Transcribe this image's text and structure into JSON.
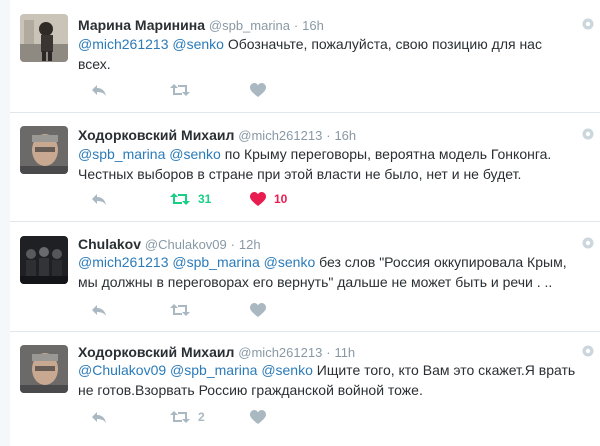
{
  "tweets": [
    {
      "name": "Марина Маринина",
      "handle": "@spb_marina",
      "time": "16h",
      "mentions": [
        "@mich261213",
        "@senko"
      ],
      "body": "Обозначьте, пожалуйста, свою позицию для нас всех.",
      "retweets": "",
      "likes": "",
      "retweeted": false,
      "liked": false
    },
    {
      "name": "Ходорковский Михаил",
      "handle": "@mich261213",
      "time": "16h",
      "mentions": [
        "@spb_marina",
        "@senko"
      ],
      "body": "по Крыму переговоры, вероятна модель Гонконга. Честных выборов в стране при этой власти не было, нет и не будет.",
      "retweets": "31",
      "likes": "10",
      "retweeted": true,
      "liked": true
    },
    {
      "name": "Chulakov",
      "handle": "@Chulakov09",
      "time": "12h",
      "mentions": [
        "@mich261213",
        "@spb_marina",
        "@senko"
      ],
      "body": "без слов \"Россия оккупировала Крым, мы должны в переговорах его вернуть\" дальше не может быть и речи . ..",
      "retweets": "",
      "likes": "",
      "retweeted": false,
      "liked": false
    },
    {
      "name": "Ходорковский Михаил",
      "handle": "@mich261213",
      "time": "11h",
      "mentions": [
        "@Chulakov09",
        "@spb_marina",
        "@senko"
      ],
      "body": "Ищите того, кто Вам это скажет.Я врать не готов.Взорвать Россию гражданской войной тоже.",
      "retweets": "2",
      "likes": "",
      "retweeted": false,
      "liked": false
    }
  ],
  "dot": "·",
  "icons": {
    "reply": "reply-icon",
    "retweet": "retweet-icon",
    "like": "heart-icon",
    "more": "chevron-down-icon"
  },
  "colors": {
    "mention": "#2b7bb9",
    "retweet_active": "#19cf86",
    "like_active": "#e81c4f",
    "icon_idle": "#aab8c2"
  }
}
